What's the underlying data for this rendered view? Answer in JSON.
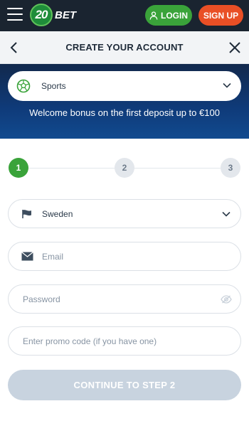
{
  "topbar": {
    "logo_number": "20",
    "logo_text": "BET",
    "login_label": "LOGIN",
    "signup_label": "SIGN UP"
  },
  "header": {
    "title": "CREATE YOUR ACCOUNT"
  },
  "banner": {
    "sport_selected": "Sports",
    "bonus_text": "Welcome bonus on the first deposit up to €100"
  },
  "steps": [
    "1",
    "2",
    "3"
  ],
  "form": {
    "country_value": "Sweden",
    "email_placeholder": "Email",
    "password_placeholder": "Password",
    "promo_placeholder": "Enter promo code (if you have one)",
    "continue_label": "CONTINUE TO STEP 2"
  },
  "colors": {
    "topbar": "#1a2430",
    "login_green": "#3aa33a",
    "signup_orange": "#e94f25",
    "banner_blue": "#0f3b7a",
    "button_disabled": "#c8d3df"
  }
}
